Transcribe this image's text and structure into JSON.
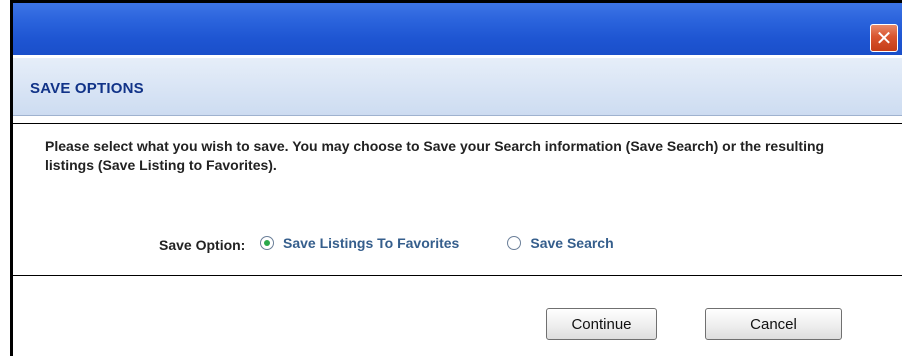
{
  "dialog": {
    "close_glyph": "✕",
    "header_title": "SAVE OPTIONS",
    "intro_text": "Please select what you wish to save.  You may choose to  Save your Search information (Save Search) or the resulting listings (Save Listing to Favorites).",
    "save_option_label": "Save Option:",
    "options": [
      {
        "label": "Save Listings To Favorites",
        "selected": true
      },
      {
        "label": "Save Search",
        "selected": false
      }
    ],
    "buttons": {
      "continue_label": "Continue",
      "cancel_label": "Cancel"
    }
  },
  "colors": {
    "titlebar": "#2a63dc",
    "close_button": "#d9552f",
    "header_text": "#113388",
    "radio_text": "#355e8c",
    "radio_selected": "#2aa84a"
  },
  "icons": {
    "close": "close-icon",
    "radio_selected": "radio-selected-icon",
    "radio_unselected": "radio-unselected-icon"
  }
}
